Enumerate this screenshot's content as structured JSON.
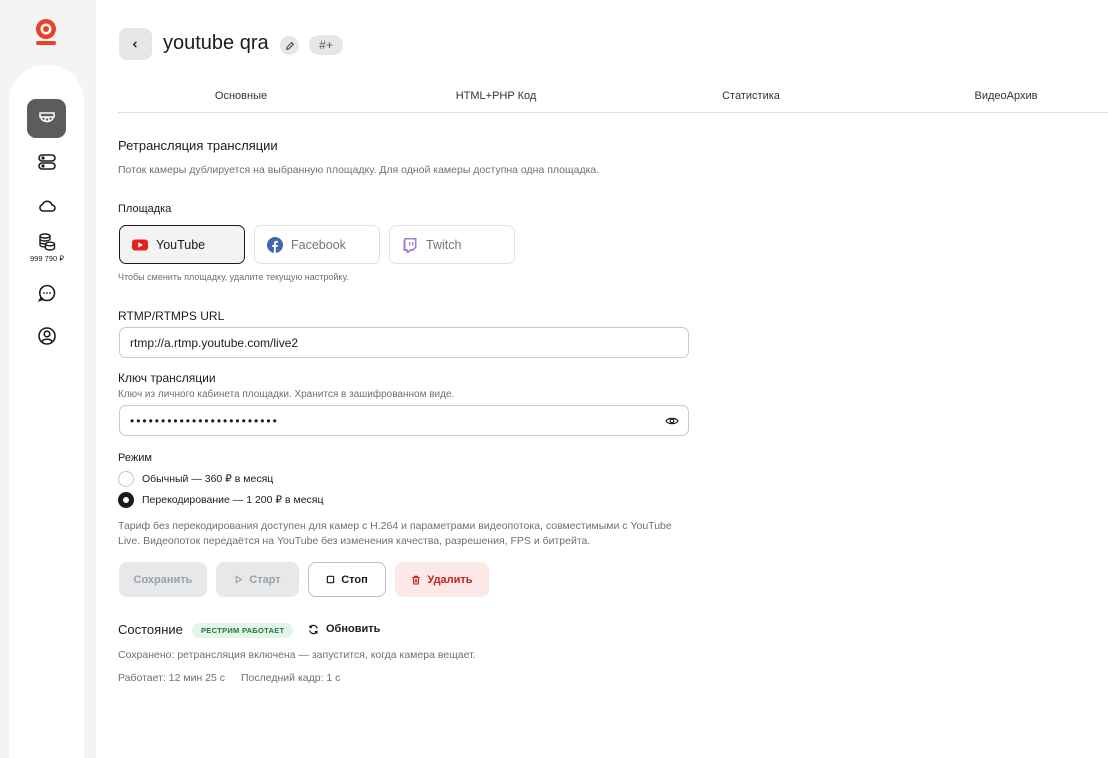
{
  "sidebar": {
    "balance": "999 790 ₽",
    "items": [
      {
        "icon": "camera-icon",
        "active": true
      },
      {
        "icon": "server-icon",
        "active": false
      },
      {
        "icon": "cloud-icon",
        "active": false
      },
      {
        "icon": "coins-icon",
        "active": false
      },
      {
        "icon": "chat-icon",
        "active": false
      },
      {
        "icon": "user-icon",
        "active": false
      }
    ]
  },
  "header": {
    "title": "youtube qra",
    "tag_label": "#+"
  },
  "tabs": [
    "Основные",
    "HTML+PHP Код",
    "Статистика",
    "ВидеоАрхив"
  ],
  "restream": {
    "title": "Ретрансляция трансляции",
    "description": "Поток камеры дублируется на выбранную площадку. Для одной камеры доступна одна площадка.",
    "platform_label": "Площадка",
    "platforms": [
      "YouTube",
      "Facebook",
      "Twitch"
    ],
    "selected_platform": "YouTube",
    "platform_hint": "Чтобы сменить площадку, удалите текущую настройку.",
    "url_label": "RTMP/RTMPS URL",
    "url_value": "rtmp://a.rtmp.youtube.com/live2",
    "key_label": "Ключ трансляции",
    "key_desc": "Ключ из личного кабинета площадки. Хранится в зашифрованном виде.",
    "key_value": "••••••••••••••••••••••••",
    "mode_label": "Режим",
    "modes": [
      "Обычный — 360 ₽ в месяц",
      "Перекодирование — 1 200 ₽ в месяц"
    ],
    "selected_mode_index": 1,
    "note": "Тариф без перекодирования доступен для камер с H.264 и параметрами видеопотока, совместимыми с YouTube Live. Видеопоток передаётся на YouTube без изменения качества, разрешения, FPS и битрейта."
  },
  "actions": {
    "save": "Сохранить",
    "start": "Старт",
    "stop": "Стоп",
    "delete": "Удалить"
  },
  "status": {
    "title": "Состояние",
    "badge": "РЕСТРИМ РАБОТАЕТ",
    "refresh": "Обновить",
    "saved_text": "Сохранено: ретрансляция включена — запустится, когда камера вещает.",
    "uptime": "Работает: 12 мин 25 с",
    "last_frame": "Последний кадр: 1 с"
  },
  "colors": {
    "accent_red": "#e8412c",
    "active_nav": "#5c5c5c",
    "badge_bg": "#e3f4e8",
    "badge_text": "#1e7a3c",
    "delete_bg": "#fce8e6",
    "delete_text": "#c5221f"
  }
}
